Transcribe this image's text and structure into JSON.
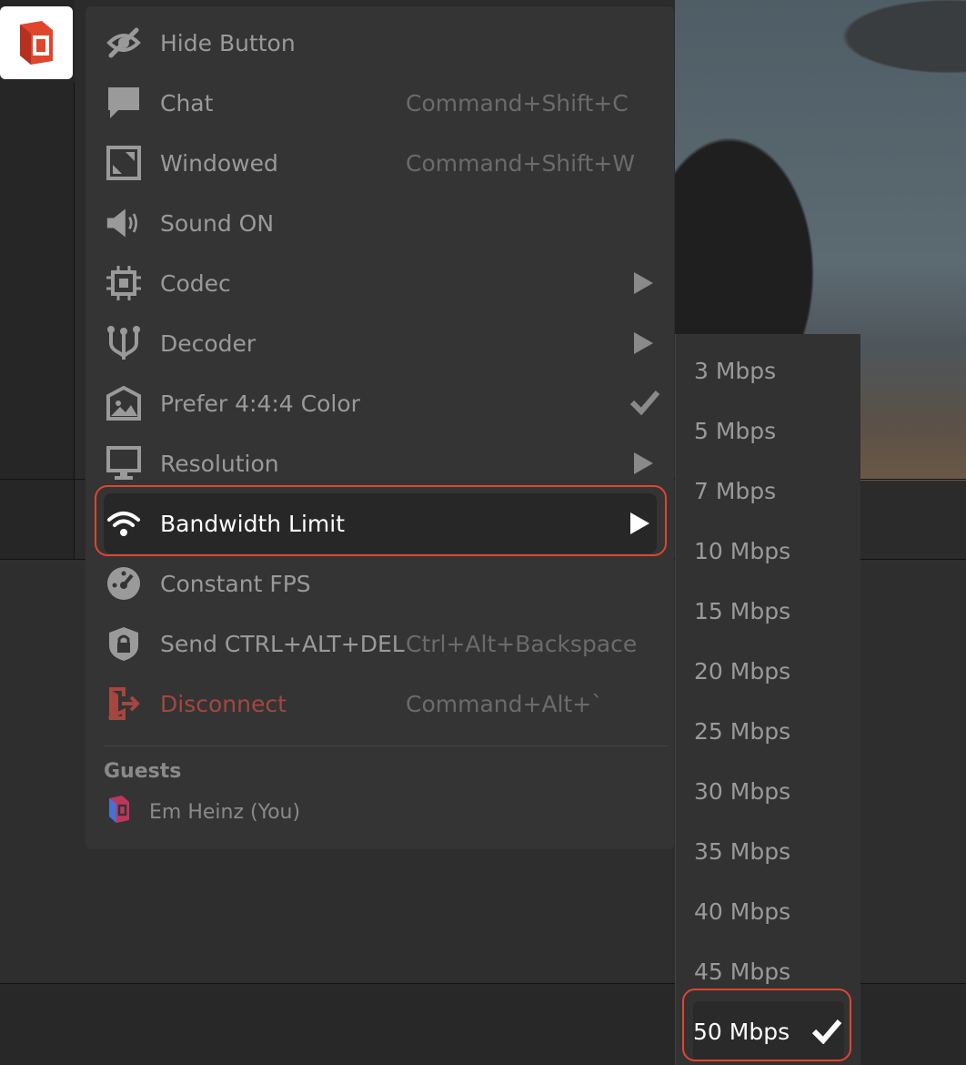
{
  "menu": {
    "items": [
      {
        "label": "Hide Button",
        "shortcut": "",
        "icon": "eye-slash-icon"
      },
      {
        "label": "Chat",
        "shortcut": "Command+Shift+C",
        "icon": "chat-bubble-icon"
      },
      {
        "label": "Windowed",
        "shortcut": "Command+Shift+W",
        "icon": "windowed-icon"
      },
      {
        "label": "Sound ON",
        "shortcut": "",
        "icon": "speaker-icon"
      },
      {
        "label": "Codec",
        "shortcut": "",
        "icon": "chip-icon",
        "submenu": true
      },
      {
        "label": "Decoder",
        "shortcut": "",
        "icon": "decoder-icon",
        "submenu": true
      },
      {
        "label": "Prefer 4:4:4 Color",
        "shortcut": "",
        "icon": "image-icon",
        "checked": true
      },
      {
        "label": "Resolution",
        "shortcut": "",
        "icon": "monitor-icon",
        "submenu": true
      },
      {
        "label": "Bandwidth Limit",
        "shortcut": "",
        "icon": "wifi-icon",
        "submenu": true,
        "active": true
      },
      {
        "label": "Constant FPS",
        "shortcut": "",
        "icon": "gauge-icon"
      },
      {
        "label": "Send CTRL+ALT+DEL",
        "shortcut": "Ctrl+Alt+Backspace",
        "icon": "lock-shield-icon"
      },
      {
        "label": "Disconnect",
        "shortcut": "Command+Alt+`",
        "icon": "exit-door-icon",
        "danger": true
      }
    ]
  },
  "guests": {
    "title": "Guests",
    "list": [
      {
        "name": "Em Heinz (You)"
      }
    ]
  },
  "bandwidth_options": {
    "items": [
      "3 Mbps",
      "5 Mbps",
      "7 Mbps",
      "10 Mbps",
      "15 Mbps",
      "20 Mbps",
      "25 Mbps",
      "30 Mbps",
      "35 Mbps",
      "40 Mbps",
      "45 Mbps",
      "50 Mbps"
    ],
    "selected": "50 Mbps"
  },
  "colors": {
    "accent": "#e0452e",
    "danger": "#a54640",
    "menu_bg": "#343434",
    "logo_red": "#e0452e"
  }
}
